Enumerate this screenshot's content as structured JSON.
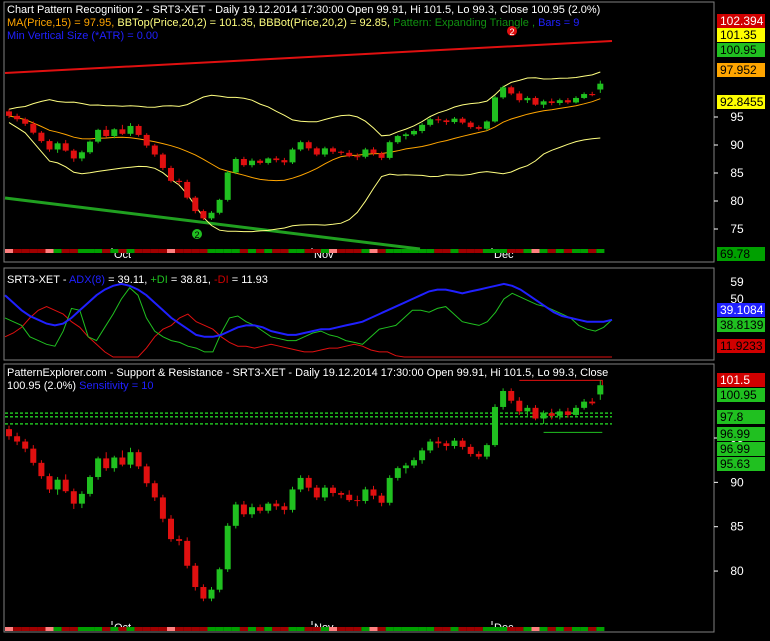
{
  "panels": {
    "p1": {
      "title": "Chart Pattern Recognition 2 - SRT3-XET - Daily 19.12.2014 17:30:00 Open 99.91, Hi 101.5, Lo 99.3, Close 100.95 (2.0%)",
      "legend": [
        {
          "text": "MA(Price,15) = 97.95, ",
          "color": "#ffa500"
        },
        {
          "text": "BBTop(Price,20,2) = 101.35, ",
          "color": "#ffff80"
        },
        {
          "text": "BBBot(Price,20,2) = 92.85, ",
          "color": "#ffff80"
        },
        {
          "text": "Pattern: Expanding Triangle , ",
          "color": "#109010"
        },
        {
          "text": "Bars = 9",
          "color": "#2020ff"
        }
      ],
      "legend2": {
        "text": "Min Vertical Size (*ATR) = 0.00",
        "color": "#2020ff"
      },
      "yticks": [
        "95",
        "90",
        "85",
        "80",
        "75"
      ],
      "tags": [
        {
          "text": "102.394",
          "bg": "#d00000",
          "fg": "#ffffff"
        },
        {
          "text": "101.35",
          "bg": "#ffff00",
          "fg": "#000000"
        },
        {
          "text": "100.95",
          "bg": "#20c020",
          "fg": "#000000"
        },
        {
          "text": "97.952",
          "bg": "#ffa500",
          "fg": "#000000"
        },
        {
          "text": "92.8455",
          "bg": "#ffff00",
          "fg": "#000000"
        },
        {
          "text": "69.78",
          "bg": "#00a000",
          "fg": "#000000"
        }
      ],
      "markers": [
        "2",
        "2"
      ]
    },
    "p2": {
      "legend": [
        {
          "text": "SRT3-XET - ",
          "color": "#ffffff"
        },
        {
          "text": "ADX(8)",
          "color": "#2020ff"
        },
        {
          "text": " = 39.11, ",
          "color": "#ffffff"
        },
        {
          "text": "+DI",
          "color": "#20c020"
        },
        {
          "text": " = 38.81, ",
          "color": "#ffffff"
        },
        {
          "text": "-DI",
          "color": "#d00000"
        },
        {
          "text": " = 11.93",
          "color": "#ffffff"
        }
      ],
      "yticks": [
        "59",
        "50"
      ],
      "tags": [
        {
          "text": "39.1084",
          "bg": "#2020ff",
          "fg": "#ffffff"
        },
        {
          "text": "38.8139",
          "bg": "#20c020",
          "fg": "#000000"
        },
        {
          "text": "11.9233",
          "bg": "#d00000",
          "fg": "#000000"
        }
      ]
    },
    "p3": {
      "line1": "PatternExplorer.com - Support & Resistance - SRT3-XET - Daily 19.12.2014 17:30:00 Open 99.91, Hi 101.5, Lo 99.3, Close",
      "line2_prefix": "100.95 (2.0%) ",
      "line2_blue": "Sensitivity = 10",
      "yticks": [
        "95",
        "90",
        "85",
        "80"
      ],
      "tags": [
        {
          "text": "101.5",
          "bg": "#d00000",
          "fg": "#ffffff"
        },
        {
          "text": "100.95",
          "bg": "#20c020",
          "fg": "#000000"
        },
        {
          "text": "97.8",
          "bg": "#20c020",
          "fg": "#000000"
        },
        {
          "text": "96.99",
          "bg": "#20c020",
          "fg": "#000000"
        },
        {
          "text": "96.99",
          "bg": "#20c020",
          "fg": "#000000"
        },
        {
          "text": "95.63",
          "bg": "#20c020",
          "fg": "#000000"
        }
      ]
    }
  },
  "x_months": [
    "Oct",
    "Nov",
    "Dec"
  ],
  "chart_data": {
    "type": "candlestick",
    "symbol": "SRT3-XET",
    "last_bar": {
      "date": "19.12.2014",
      "open": 99.91,
      "high": 101.5,
      "low": 99.3,
      "close": 100.95,
      "change": "2.0%"
    },
    "ohlc": [
      [
        96.0,
        96.4,
        94.8,
        95.2
      ],
      [
        95.2,
        95.6,
        94.2,
        94.6
      ],
      [
        94.6,
        94.9,
        93.4,
        93.8
      ],
      [
        93.8,
        94.2,
        91.9,
        92.2
      ],
      [
        92.2,
        92.5,
        90.4,
        90.7
      ],
      [
        90.7,
        91.0,
        88.8,
        89.2
      ],
      [
        89.2,
        90.6,
        88.6,
        90.3
      ],
      [
        90.3,
        90.9,
        88.8,
        89.0
      ],
      [
        89.0,
        89.3,
        87.0,
        87.6
      ],
      [
        87.6,
        89.0,
        87.1,
        88.7
      ],
      [
        88.7,
        90.8,
        88.4,
        90.6
      ],
      [
        90.6,
        92.9,
        90.3,
        92.7
      ],
      [
        92.7,
        93.4,
        91.3,
        91.6
      ],
      [
        91.6,
        93.0,
        91.2,
        92.8
      ],
      [
        92.8,
        93.6,
        91.8,
        92.0
      ],
      [
        92.0,
        93.9,
        91.6,
        93.4
      ],
      [
        93.4,
        93.7,
        91.5,
        91.8
      ],
      [
        91.8,
        92.1,
        89.5,
        89.9
      ],
      [
        89.9,
        90.2,
        87.9,
        88.3
      ],
      [
        88.3,
        88.6,
        85.5,
        85.9
      ],
      [
        85.9,
        86.3,
        83.3,
        83.6
      ],
      [
        83.6,
        84.0,
        82.9,
        83.4
      ],
      [
        83.4,
        83.8,
        80.3,
        80.6
      ],
      [
        80.6,
        80.9,
        77.8,
        78.2
      ],
      [
        78.2,
        78.5,
        76.6,
        76.9
      ],
      [
        76.9,
        78.2,
        76.6,
        77.9
      ],
      [
        77.9,
        80.4,
        77.6,
        80.2
      ],
      [
        80.2,
        85.4,
        79.9,
        85.1
      ],
      [
        85.1,
        87.8,
        84.8,
        87.5
      ],
      [
        87.5,
        87.9,
        86.1,
        86.4
      ],
      [
        86.4,
        87.6,
        86.0,
        87.2
      ],
      [
        87.2,
        87.5,
        86.5,
        86.8
      ],
      [
        86.8,
        87.8,
        86.5,
        87.6
      ],
      [
        87.6,
        88.0,
        86.9,
        87.3
      ],
      [
        87.3,
        87.7,
        86.4,
        86.9
      ],
      [
        86.9,
        89.5,
        86.6,
        89.2
      ],
      [
        89.2,
        90.8,
        88.9,
        90.5
      ],
      [
        90.5,
        90.8,
        89.0,
        89.4
      ],
      [
        89.4,
        89.7,
        88.0,
        88.3
      ],
      [
        88.3,
        89.7,
        87.9,
        89.4
      ],
      [
        89.4,
        89.7,
        88.4,
        88.8
      ],
      [
        88.8,
        89.0,
        88.2,
        88.6
      ],
      [
        88.6,
        89.1,
        87.8,
        88.0
      ],
      [
        88.0,
        88.5,
        87.3,
        87.9
      ],
      [
        87.9,
        89.5,
        87.6,
        89.2
      ],
      [
        89.2,
        89.6,
        88.1,
        88.5
      ],
      [
        88.5,
        88.8,
        87.3,
        87.7
      ],
      [
        87.7,
        90.8,
        87.4,
        90.5
      ],
      [
        90.5,
        91.8,
        90.2,
        91.6
      ],
      [
        91.6,
        92.2,
        91.0,
        91.9
      ],
      [
        91.9,
        92.8,
        91.6,
        92.5
      ],
      [
        92.5,
        93.9,
        92.1,
        93.6
      ],
      [
        93.6,
        94.9,
        93.3,
        94.6
      ],
      [
        94.6,
        95.1,
        93.9,
        94.4
      ],
      [
        94.4,
        94.7,
        93.6,
        94.1
      ],
      [
        94.1,
        95.0,
        93.8,
        94.7
      ],
      [
        94.7,
        95.0,
        93.7,
        94.0
      ],
      [
        94.0,
        94.3,
        92.9,
        93.2
      ],
      [
        93.2,
        93.5,
        92.6,
        92.9
      ],
      [
        92.9,
        94.4,
        92.6,
        94.2
      ],
      [
        94.2,
        98.8,
        94.0,
        98.5
      ],
      [
        98.5,
        100.6,
        98.2,
        100.3
      ],
      [
        100.3,
        100.6,
        98.9,
        99.2
      ],
      [
        99.2,
        99.6,
        97.6,
        98.0
      ],
      [
        98.0,
        98.7,
        97.5,
        98.4
      ],
      [
        98.4,
        98.7,
        97.0,
        97.2
      ],
      [
        97.2,
        98.1,
        96.6,
        97.8
      ],
      [
        97.8,
        98.3,
        97.1,
        97.5
      ],
      [
        97.5,
        98.3,
        97.1,
        98.0
      ],
      [
        98.0,
        98.4,
        97.3,
        97.6
      ],
      [
        97.6,
        98.7,
        97.4,
        98.4
      ],
      [
        98.4,
        99.4,
        98.2,
        99.1
      ],
      [
        99.1,
        99.5,
        98.7,
        98.9
      ],
      [
        99.91,
        101.5,
        99.3,
        100.95
      ]
    ],
    "ma15_last": 97.95,
    "bbtop_last": 101.35,
    "bbbot_last": 92.85,
    "adx_last": 39.11,
    "plus_di_last": 38.81,
    "minus_di_last": 11.93,
    "support_resistance": [
      101.5,
      100.95,
      97.8,
      96.99,
      96.99,
      95.63
    ]
  }
}
